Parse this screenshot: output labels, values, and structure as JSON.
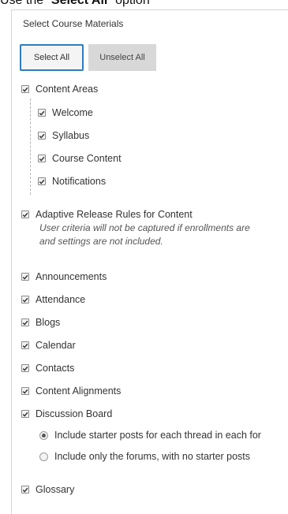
{
  "header": {
    "prefix": "Use the “",
    "bold": "Select All",
    "suffix": "” option"
  },
  "panel": {
    "title": "Select Course Materials",
    "select_all": "Select All",
    "unselect_all": "Unselect All"
  },
  "content_areas": {
    "label": "Content Areas",
    "children": [
      "Welcome",
      "Syllabus",
      "Course Content",
      "Notifications"
    ]
  },
  "adaptive": {
    "label": "Adaptive Release Rules for Content",
    "note_line1": "User criteria will not be captured if enrollments are",
    "note_line2": "and settings are not included."
  },
  "items": [
    "Announcements",
    "Attendance",
    "Blogs",
    "Calendar",
    "Contacts",
    "Content Alignments",
    "Discussion Board"
  ],
  "discussion_options": [
    "Include starter posts for each thread in each for",
    "Include only the forums, with no starter posts"
  ],
  "last_item": "Glossary"
}
